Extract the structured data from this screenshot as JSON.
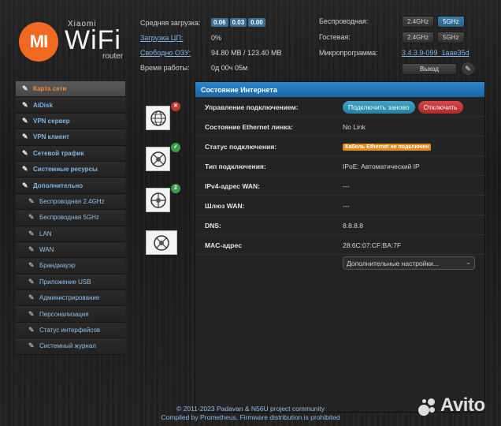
{
  "brand": {
    "mi": "MI",
    "xiaomi": "Xiaomi",
    "wifi": "WiFi",
    "router": "router",
    "logo_color": "#f26a21"
  },
  "stats": {
    "load_label": "Средняя загрузка:",
    "load_values": [
      "0.06",
      "0.03",
      "0.00"
    ],
    "cpu_label": "Загрузка ЦП:",
    "cpu_value": "0%",
    "ram_label": "Свободно ОЗУ:",
    "ram_value": "94.80 MB / 123.40 MB",
    "uptime_label": "Время работы:",
    "uptime_value": "0д 00ч 05м"
  },
  "right_stats": {
    "wireless_label": "Беспроводная:",
    "guest_label": "Гостевая:",
    "band_24": "2.4GHz",
    "band_5": "5GHz",
    "firmware_label": "Микропрограмма:",
    "firmware_value": "3.4.3.9-099_1aae35d",
    "logout_label": "Выход",
    "edit_icon": "pencil-icon"
  },
  "sidebar": {
    "items": [
      {
        "label": "Карта сети",
        "icon": "pencil-icon"
      },
      {
        "label": "AiDisk",
        "icon": "pencil-icon"
      },
      {
        "label": "VPN сервер",
        "icon": "pencil-icon"
      },
      {
        "label": "VPN клиент",
        "icon": "pencil-icon"
      },
      {
        "label": "Сетевой трафик",
        "icon": "pencil-icon"
      },
      {
        "label": "Системные ресурсы",
        "icon": "pencil-icon"
      },
      {
        "label": "Дополнительно",
        "icon": "pencil-icon"
      },
      {
        "label": "Беспроводная 2.4GHz",
        "icon": "pencil-icon"
      },
      {
        "label": "Беспроводная 5GHz",
        "icon": "pencil-icon"
      },
      {
        "label": "LAN",
        "icon": "pencil-icon"
      },
      {
        "label": "WAN",
        "icon": "pencil-icon"
      },
      {
        "label": "Брандмауэр",
        "icon": "pencil-icon"
      },
      {
        "label": "Приложение USB",
        "icon": "pencil-icon"
      },
      {
        "label": "Администрирование",
        "icon": "pencil-icon"
      },
      {
        "label": "Персонализация",
        "icon": "pencil-icon"
      },
      {
        "label": "Статус интерфейсов",
        "icon": "pencil-icon"
      },
      {
        "label": "Системный журнал",
        "icon": "pencil-icon"
      }
    ]
  },
  "netmap": {
    "clients_count": "2",
    "icons": [
      "globe-icon",
      "router-icon",
      "clients-icon",
      "usb-icon"
    ]
  },
  "panel": {
    "title": "Состояние Интернета",
    "rows": [
      {
        "label": "Управление подключением:"
      },
      {
        "label": "Состояние Ethernet линка:",
        "value": "No Link"
      },
      {
        "label": "Статус подключения:",
        "value": "Кабель Ethernet не подключен"
      },
      {
        "label": "Тип подключения:",
        "value": "IPoE: Автоматический IP"
      },
      {
        "label": "IPv4-адрес WAN:",
        "value": "---"
      },
      {
        "label": "Шлюз WAN:",
        "value": "---"
      },
      {
        "label": "DNS:",
        "value": "8.8.8.8"
      },
      {
        "label": "MAC-адрес",
        "value": "28:6C:07:CF:BA:7F"
      }
    ],
    "reconnect_label": "Подключить заново",
    "disconnect_label": "Отключить",
    "more_settings": "Дополнительные настройки..."
  },
  "footer": {
    "line1": "© 2011-2023 Padavan & N56U project community",
    "line2": "Compiled by Prometheus. Firmware distribution is prohibited"
  },
  "watermark": {
    "text": "Avito"
  }
}
